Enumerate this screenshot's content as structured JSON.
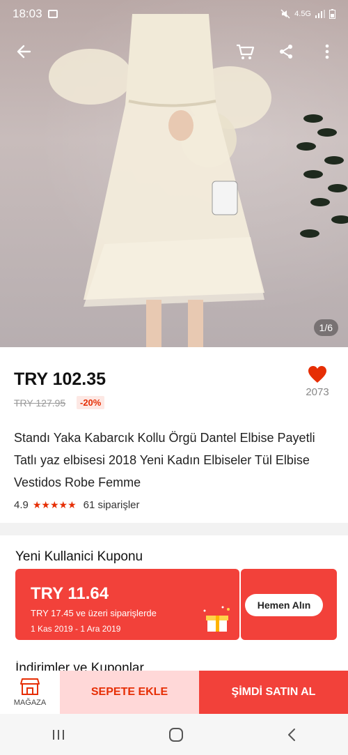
{
  "status_bar": {
    "time": "18:03",
    "network": "4.5G"
  },
  "gallery": {
    "indicator": "1/6"
  },
  "product": {
    "price": "TRY 102.35",
    "old_price": "TRY 127.95",
    "discount": "-20%",
    "wishlist_count": "2073",
    "title": "Standı Yaka Kabarcık Kollu Örgü Dantel Elbise Payetli Tatlı yaz elbisesi 2018 Yeni Kadın Elbiseler Tül Elbise Vestidos Robe Femme",
    "rating": "4.9",
    "stars": "★★★★★",
    "orders": "61 siparişler"
  },
  "coupon": {
    "section_title": "Yeni Kullanici Kuponu",
    "amount": "TRY 11.64",
    "condition": "TRY 17.45 ve üzeri siparişlerde",
    "dates": "1 Kas 2019 - 1 Ara 2019",
    "claim_label": "Hemen Alın"
  },
  "next_section_title": "İndirimler ve Kuponlar",
  "actions": {
    "store_label": "MAĞAZA",
    "add_to_cart": "SEPETE EKLE",
    "buy_now": "ŞİMDİ SATIN AL"
  },
  "colors": {
    "accent": "#f2413a",
    "price_red": "#e62e04",
    "cart_bg": "#ffd8d8"
  },
  "icons": [
    "back-arrow-icon",
    "cart-icon",
    "share-icon",
    "more-vert-icon",
    "heart-icon",
    "store-icon",
    "recents-icon",
    "home-icon",
    "back-nav-icon"
  ]
}
